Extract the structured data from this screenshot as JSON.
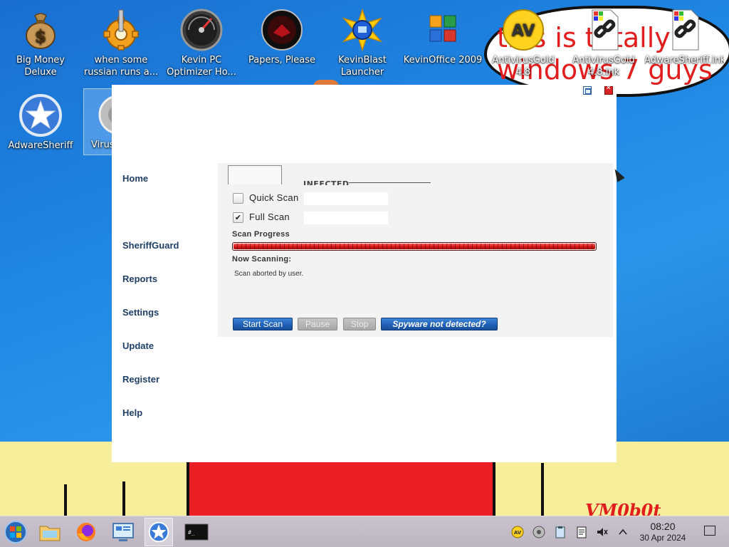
{
  "wallpaper": {
    "line1": "this is totally",
    "line2": "windows 7 guys",
    "signature": "VM0b0t"
  },
  "desktop_icons": [
    {
      "label": "Big Money Deluxe",
      "icon": "money-bag-icon"
    },
    {
      "label": "when some russian runs a...",
      "icon": "gear-icon"
    },
    {
      "label": "Kevin PC Optimizer Ho...",
      "icon": "gauge-icon"
    },
    {
      "label": "Papers, Please",
      "icon": "papers-please-icon"
    },
    {
      "label": "KevinBlast Launcher",
      "icon": "kevinblast-icon"
    },
    {
      "label": "KevinOffice 2009",
      "icon": "office-icon"
    },
    {
      "label": "AntivirusGold 4.8",
      "icon": "av-gold-icon"
    },
    {
      "label": "AntivirusGold 4.8.lnk",
      "icon": "link-file-icon"
    },
    {
      "label": "AdwareSheriff.lnk",
      "icon": "link-file-icon"
    },
    {
      "label": "AdwareSheriff",
      "icon": "sheriff-star-icon"
    },
    {
      "label": "Virus",
      "icon": "virus-icon"
    }
  ],
  "window": {
    "nav": [
      "Home",
      "SheriffGuard",
      "Reports",
      "Settings",
      "Update",
      "Register",
      "Help"
    ],
    "tab_label": "INFECTED",
    "options": [
      {
        "label": "Quick Scan",
        "checked": false
      },
      {
        "label": "Full Scan",
        "checked": true
      }
    ],
    "scan_progress_label": "Scan Progress",
    "progress_fraction": 1.0,
    "now_scanning_label": "Now Scanning:",
    "status_message": "Scan aborted by user.",
    "buttons": {
      "start": "Start Scan",
      "pause": "Pause",
      "stop": "Stop",
      "spyware": "Spyware not detected?"
    }
  },
  "taskbar": {
    "start_icon": "start-orb-icon",
    "pinned": [
      "file-manager-icon",
      "firefox-icon",
      "control-panel-icon",
      "adware-sheriff-taskbar-icon",
      "terminal-icon"
    ],
    "tray": [
      "antivirus-tray-icon",
      "disc-tray-icon",
      "clipboard-tray-icon",
      "notes-tray-icon",
      "volume-muted-icon",
      "chevron-up-icon"
    ],
    "time": "08:20",
    "date": "30 Apr 2024"
  },
  "colors": {
    "nav_text": "#1f3f68",
    "progress": "#d31616",
    "button_blue": "#1e5eb4",
    "desktop": "#1f86e3"
  }
}
